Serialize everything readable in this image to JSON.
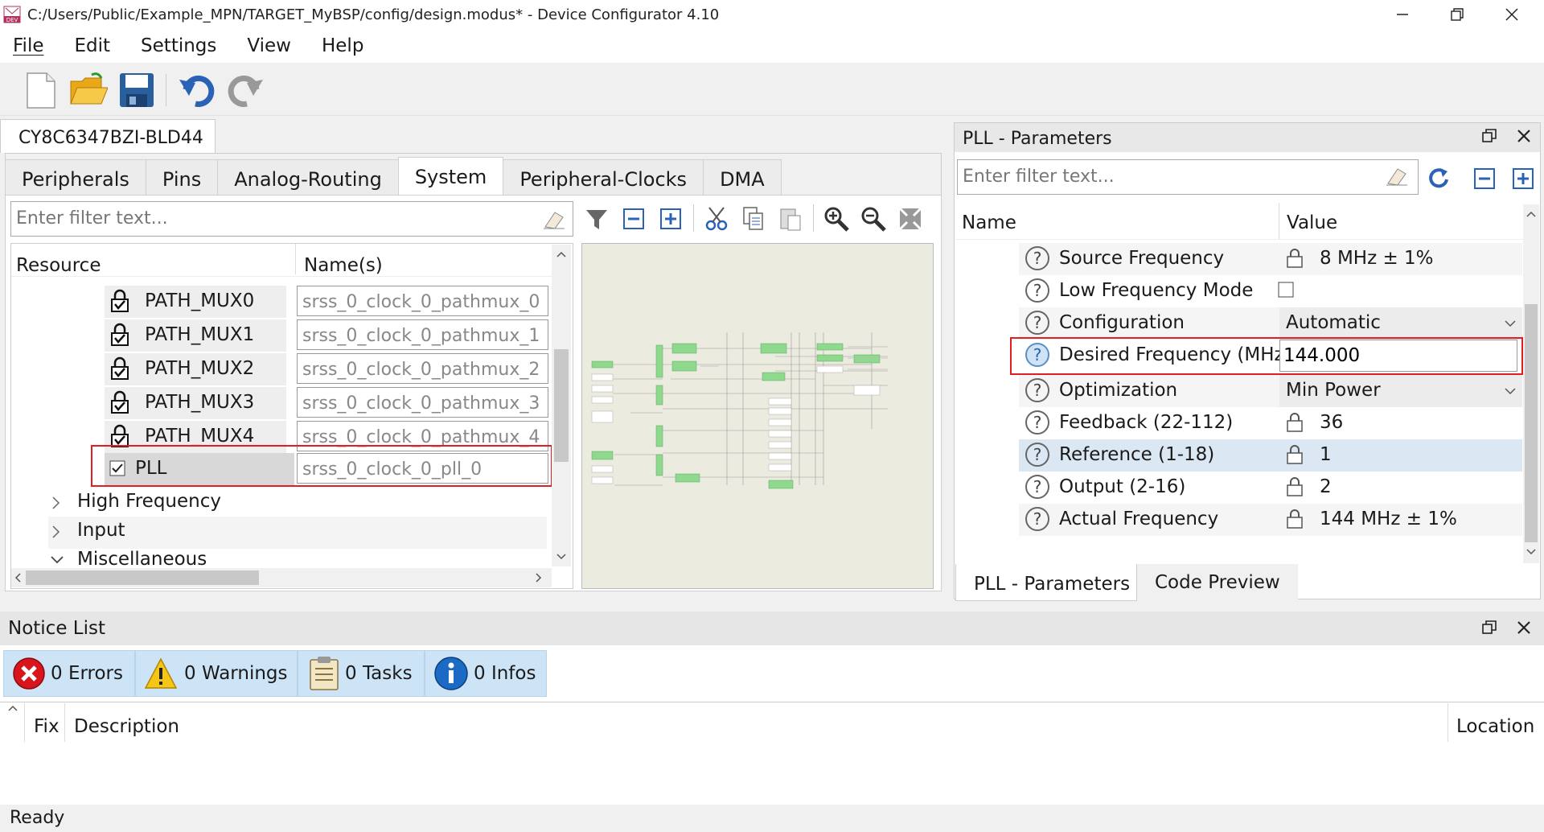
{
  "window": {
    "title": "C:/Users/Public/Example_MPN/TARGET_MyBSP/config/design.modus* - Device Configurator 4.10",
    "app_icon_text": "DEV"
  },
  "menu": [
    "File",
    "Edit",
    "Settings",
    "View",
    "Help"
  ],
  "device": {
    "name": "CY8C6347BZI-BLD44"
  },
  "tabs": [
    "Peripherals",
    "Pins",
    "Analog-Routing",
    "System",
    "Peripheral-Clocks",
    "DMA"
  ],
  "active_tab": "System",
  "filter_placeholder": "Enter filter text...",
  "tree": {
    "col_resource": "Resource",
    "col_names": "Name(s)",
    "rows": [
      {
        "label": "PATH_MUX0",
        "name": "srss_0_clock_0_pathmux_0"
      },
      {
        "label": "PATH_MUX1",
        "name": "srss_0_clock_0_pathmux_1"
      },
      {
        "label": "PATH_MUX2",
        "name": "srss_0_clock_0_pathmux_2"
      },
      {
        "label": "PATH_MUX3",
        "name": "srss_0_clock_0_pathmux_3"
      },
      {
        "label": "PATH_MUX4",
        "name": "srss_0_clock_0_pathmux_4"
      },
      {
        "label": "PLL",
        "name": "srss_0_clock_0_pll_0",
        "checked": true
      }
    ],
    "groups": [
      "High Frequency",
      "Input",
      "Miscellaneous"
    ]
  },
  "params": {
    "panel_title": "PLL - Parameters",
    "filter_placeholder": "Enter filter text...",
    "col_name": "Name",
    "col_value": "Value",
    "rows": [
      {
        "name": "Source Frequency",
        "value": "8 MHz ± 1%",
        "locked": true
      },
      {
        "name": "Low Frequency Mode",
        "value": "",
        "checkbox": true
      },
      {
        "name": "Configuration",
        "value": "Automatic",
        "dropdown": true
      },
      {
        "name": "Desired Frequency (MHz)",
        "value": "144.000",
        "editing": true
      },
      {
        "name": "Optimization",
        "value": "Min Power",
        "dropdown": true
      },
      {
        "name": "Feedback (22-112)",
        "value": "36",
        "locked": true
      },
      {
        "name": "Reference (1-18)",
        "value": "1",
        "locked": true
      },
      {
        "name": "Output (2-16)",
        "value": "2",
        "locked": true
      },
      {
        "name": "Actual Frequency",
        "value": "144 MHz ± 1%",
        "locked": true
      }
    ],
    "bottom_tabs": [
      "PLL - Parameters",
      "Code Preview"
    ]
  },
  "notice": {
    "title": "Notice List",
    "errors": "0 Errors",
    "warnings": "0 Warnings",
    "tasks": "0 Tasks",
    "infos": "0 Infos",
    "col_fix": "Fix",
    "col_description": "Description",
    "col_location": "Location"
  },
  "status": "Ready",
  "colors": {
    "accent_red": "#e02020",
    "green_block": "#8ed98e",
    "selected_row": "#dbe8f3",
    "notice_tab": "#cde4f7"
  }
}
